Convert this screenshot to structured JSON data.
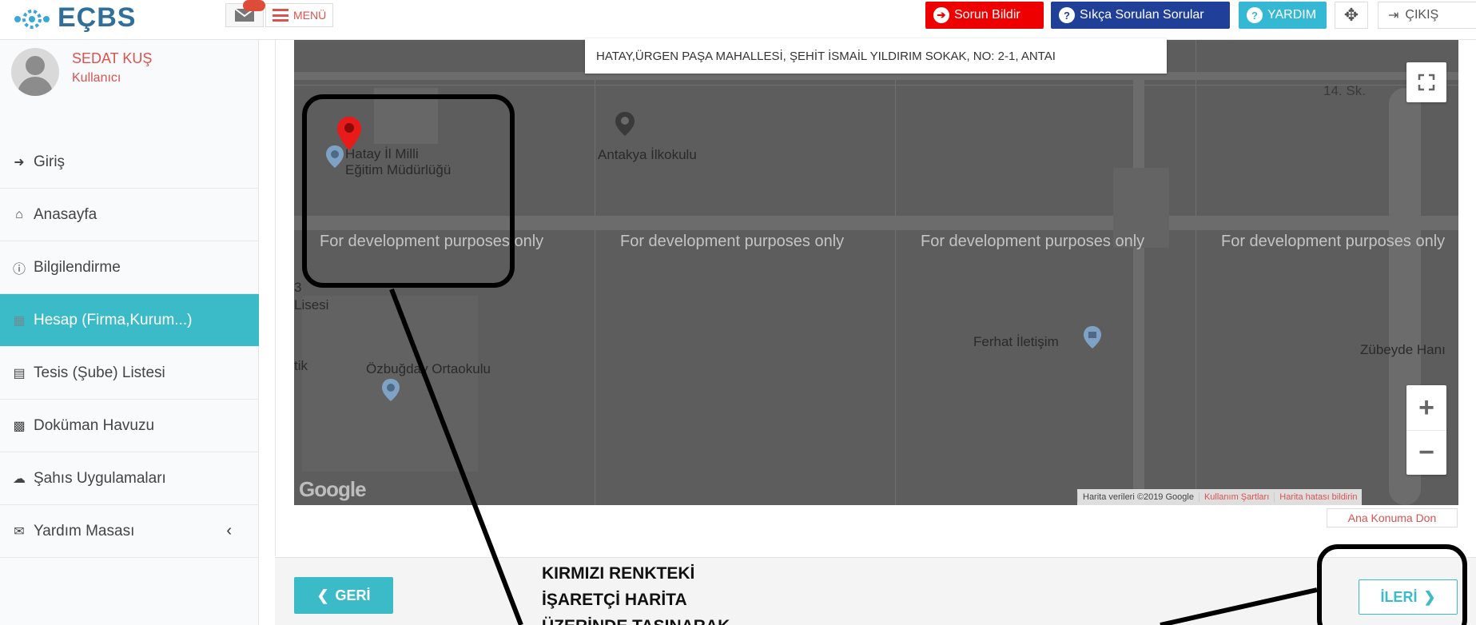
{
  "app": {
    "logo_text": "EÇBS"
  },
  "topbar": {
    "menu_label": "MENÜ",
    "report_label": "Sorun Bildir",
    "faq_label": "Sıkça Sorulan Sorular",
    "help_label": "YARDIM",
    "exit_label": "ÇIKIŞ",
    "colors": {
      "report": "#e00000",
      "faq": "#1f3f99",
      "help": "#35b8d3"
    }
  },
  "user": {
    "name": "SEDAT KUŞ",
    "role": "Kullanıcı"
  },
  "sidebar": {
    "items": [
      {
        "label": "Giriş",
        "icon": "sign-in-icon",
        "active": false
      },
      {
        "label": "Anasayfa",
        "icon": "home-icon",
        "active": false
      },
      {
        "label": "Bilgilendirme",
        "icon": "info-icon",
        "active": false
      },
      {
        "label": "Hesap (Firma,Kurum...)",
        "icon": "building-icon",
        "active": true
      },
      {
        "label": "Tesis (Şube) Listesi",
        "icon": "clipboard-icon",
        "active": false
      },
      {
        "label": "Doküman Havuzu",
        "icon": "boxes-icon",
        "active": false
      },
      {
        "label": "Şahıs Uygulamaları",
        "icon": "cloud-icon",
        "active": false
      },
      {
        "label": "Yardım Masası",
        "icon": "envelope-icon",
        "active": false
      }
    ]
  },
  "map": {
    "address": "HATAY,ÜRGEN PAŞA MAHALLESİ, ŞEHİT İSMAİL YILDIRIM SOKAK, NO: 2-1, ANTAI",
    "dev_watermark": "For development purposes only",
    "street_label": "14. Sk.",
    "places": {
      "mem_line1": "Hatay İl Milli",
      "mem_line2": "Eğitim Müdürlüğü",
      "antakya": "Antakya İlkokulu",
      "lisesi_prefix": "3",
      "lisesi": "Lisesi",
      "tik": "tik",
      "ozbugday": "Özbuğday Ortaokulu",
      "ferhat": "Ferhat İletişim",
      "zubeyde": "Zübeyde Hanı"
    },
    "google_logo": "Google",
    "attribution": "Harita verileri ©2019 Google",
    "terms": "Kullanım Şartları",
    "report_error": "Harita hatası bildirin",
    "return_home": "Ana Konuma Don"
  },
  "nav_buttons": {
    "back": "GERİ",
    "next": "İLERİ"
  },
  "annotation": {
    "line1": "KIRMIZI RENKTEKİ",
    "line2": "İŞARETÇİ HARİTA",
    "line3": "ÜZERİNDE TAŞINARAK"
  }
}
